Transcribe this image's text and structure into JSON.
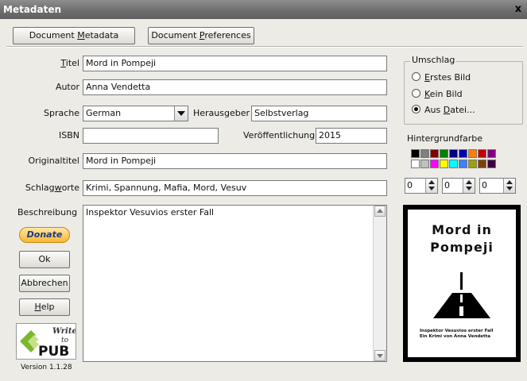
{
  "window": {
    "title": "Metadaten",
    "close_glyph": "x"
  },
  "toolbar": {
    "metadata_button": {
      "before": "Document ",
      "accel": "M",
      "after": "etadata"
    },
    "preferences_button": {
      "before": "Document ",
      "accel": "P",
      "after": "references"
    }
  },
  "form": {
    "titel": {
      "label_accel": "T",
      "label_rest": "itel",
      "value": "Mord in Pompeji"
    },
    "autor": {
      "label": "Autor",
      "value": "Anna Vendetta"
    },
    "sprache": {
      "label": "Sprache",
      "value": "German"
    },
    "herausgeber": {
      "label": "Herausgeber",
      "value": "Selbstverlag"
    },
    "isbn": {
      "label": "ISBN",
      "value": ""
    },
    "veroeffentlichung": {
      "label": "Veröffentlichung",
      "value": "2015"
    },
    "originaltitel": {
      "label": "Originaltitel",
      "value": "Mord in Pompeji"
    },
    "schlagworte": {
      "label_before": "Schlag",
      "label_accel": "w",
      "label_after": "orte",
      "value": "Krimi, Spannung, Mafia, Mord, Vesuv"
    },
    "beschreibung": {
      "label": "Beschreibung",
      "value": "Inspektor Vesuvios erster Fall"
    }
  },
  "buttons": {
    "donate": "Donate",
    "ok": "Ok",
    "abbrechen": "Abbrechen",
    "help": {
      "accel": "H",
      "rest": "elp"
    }
  },
  "logo": {
    "writer": "Writer",
    "to": "to",
    "pub": "PUB"
  },
  "version": "Version 1.1.28",
  "umschlag": {
    "legend": "Umschlag",
    "options": [
      {
        "accel": "E",
        "rest": "rstes Bild",
        "checked": false
      },
      {
        "accel": "K",
        "rest": "ein Bild",
        "checked": false
      },
      {
        "before": "Aus ",
        "accel": "D",
        "rest": "atei...",
        "checked": true
      }
    ]
  },
  "background_color": {
    "label": "Hintergrundfarbe",
    "palette_row1": [
      "#000000",
      "#808080",
      "#800000",
      "#008000",
      "#000080",
      "#0000aa",
      "#ff8000",
      "#c00000",
      "#800080"
    ],
    "palette_row2": [
      "#ffffff",
      "#c0c0c0",
      "#ff00ff",
      "#ffff00",
      "#00ffff",
      "#4080ff",
      "#a0a000",
      "#804000",
      "#400040"
    ],
    "r": "0",
    "g": "0",
    "b": "0"
  },
  "cover": {
    "title_line1": "Mord in",
    "title_line2": "Pompeji",
    "sub1": "Inspektor Vesuvios erster Fall",
    "sub2": "Ein Krimi von Anna Vendetta"
  }
}
